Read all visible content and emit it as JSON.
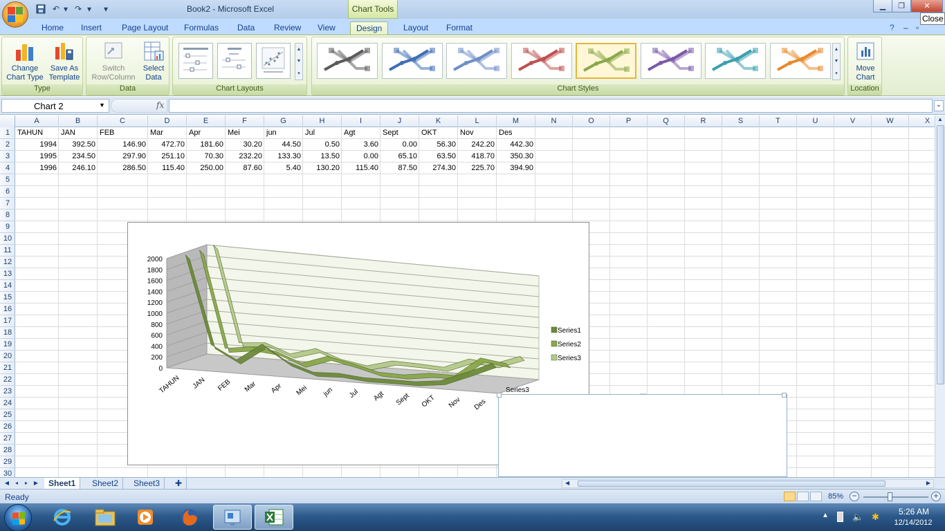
{
  "window": {
    "title": "Book2 - Microsoft Excel",
    "context_tab": "Chart Tools",
    "close_tooltip": "Close"
  },
  "tabs": [
    "Home",
    "Insert",
    "Page Layout",
    "Formulas",
    "Data",
    "Review",
    "View",
    "Design",
    "Layout",
    "Format"
  ],
  "active_tab": "Design",
  "ribbon": {
    "type_group": {
      "label": "Type",
      "change_chart_type": "Change\nChart Type",
      "save_as_template": "Save As\nTemplate"
    },
    "data_group": {
      "label": "Data",
      "switch_row_column": "Switch\nRow/Column",
      "select_data": "Select\nData"
    },
    "layouts_group": {
      "label": "Chart Layouts"
    },
    "styles_group": {
      "label": "Chart Styles",
      "colors": [
        "#5a5a5a",
        "#3f6fb5",
        "#6f8fc6",
        "#c05050",
        "#8aa84a",
        "#7a5aa8",
        "#3a9fb0",
        "#e68a2e"
      ],
      "selected_index": 4
    },
    "location_group": {
      "label": "Location",
      "move_chart": "Move\nChart"
    }
  },
  "formula_bar": {
    "name_box": "Chart 2",
    "fx": "fx",
    "value": ""
  },
  "columns": [
    "A",
    "B",
    "C",
    "D",
    "E",
    "F",
    "G",
    "H",
    "I",
    "J",
    "K",
    "L",
    "M",
    "N",
    "O",
    "P",
    "Q",
    "R",
    "S",
    "T",
    "U",
    "V",
    "W",
    "X"
  ],
  "rows": [
    "1",
    "2",
    "3",
    "4",
    "5",
    "6",
    "7",
    "8",
    "9",
    "10",
    "11",
    "12",
    "13",
    "14",
    "15",
    "16",
    "17",
    "18",
    "19",
    "20",
    "21",
    "22",
    "23",
    "24",
    "25",
    "26",
    "27",
    "28",
    "29",
    "30"
  ],
  "sheet": {
    "header": [
      "TAHUN",
      "JAN",
      "FEB",
      "Mar",
      "Apr",
      "Mei",
      "jun",
      "Jul",
      "Agt",
      "Sept",
      "OKT",
      "Nov",
      "Des"
    ],
    "data": [
      [
        "1994",
        "392.50",
        "146.90",
        "472.70",
        "181.60",
        "30.20",
        "44.50",
        "0.50",
        "3.60",
        "0.00",
        "56.30",
        "242.20",
        "442.30"
      ],
      [
        "1995",
        "234.50",
        "297.90",
        "251.10",
        "70.30",
        "232.20",
        "133.30",
        "13.50",
        "0.00",
        "65.10",
        "63.50",
        "418.70",
        "350.30"
      ],
      [
        "1996",
        "246.10",
        "286.50",
        "115.40",
        "250.00",
        "87.60",
        "5.40",
        "130.20",
        "115.40",
        "87.50",
        "274.30",
        "225.70",
        "394.90"
      ]
    ]
  },
  "chart_data": {
    "type": "line",
    "subtype": "3d-line",
    "categories": [
      "TAHUN",
      "JAN",
      "FEB",
      "Mar",
      "Apr",
      "Mei",
      "jun",
      "Jul",
      "Agt",
      "Sept",
      "OKT",
      "Nov",
      "Des"
    ],
    "series": [
      {
        "name": "Series1",
        "values": [
          1994,
          392.5,
          146.9,
          472.7,
          181.6,
          30.2,
          44.5,
          0.5,
          3.6,
          0.0,
          56.3,
          242.2,
          442.3
        ],
        "color": "#6d8a3a"
      },
      {
        "name": "Series2",
        "values": [
          1995,
          234.5,
          297.9,
          251.1,
          70.3,
          232.2,
          133.3,
          13.5,
          0.0,
          65.1,
          63.5,
          418.7,
          350.3
        ],
        "color": "#8aa84a"
      },
      {
        "name": "Series3",
        "values": [
          1996,
          246.1,
          286.5,
          115.4,
          250.0,
          87.6,
          5.4,
          130.2,
          115.4,
          87.5,
          274.3,
          225.7,
          394.9
        ],
        "color": "#b4c98a"
      }
    ],
    "y_ticks": [
      "2000",
      "1800",
      "1600",
      "1400",
      "1200",
      "1000",
      "800",
      "600",
      "400",
      "200",
      "0"
    ],
    "ylim": [
      0,
      2000
    ],
    "depth_axis_label": "Series3",
    "legend_entries": [
      "Series1",
      "Series2",
      "Series3"
    ],
    "legend_position": "right",
    "grid": true
  },
  "sheet_tabs": [
    "Sheet1",
    "Sheet2",
    "Sheet3"
  ],
  "active_sheet": "Sheet1",
  "status": {
    "text": "Ready",
    "zoom": "85%"
  },
  "taskbar": {
    "apps": [
      "internet-explorer",
      "file-explorer",
      "media-player",
      "firefox",
      "control-panel",
      "excel"
    ],
    "time": "5:26 AM",
    "date": "12/14/2012"
  }
}
